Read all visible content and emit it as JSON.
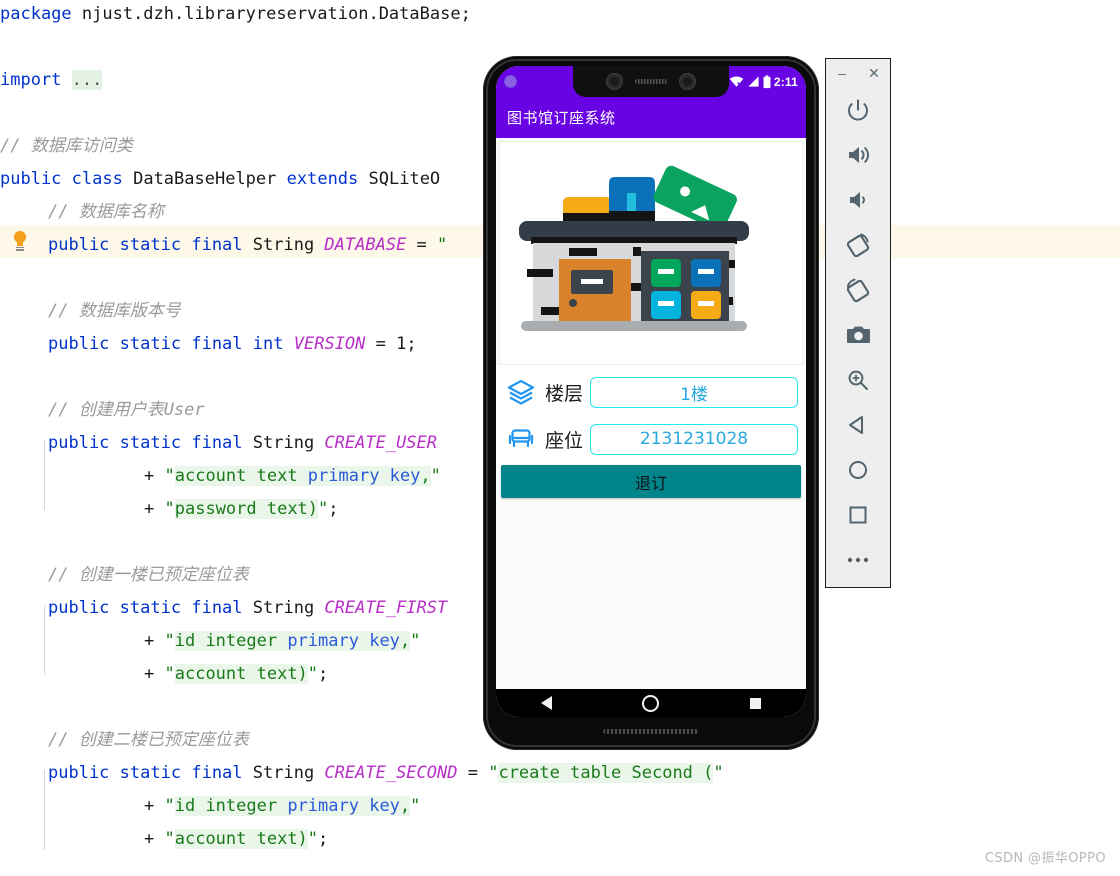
{
  "editor": {
    "lines": [
      {
        "id": "l1",
        "indent": 0,
        "highlight": false,
        "tokens": [
          {
            "t": "kw",
            "v": "package"
          },
          {
            "t": "plain",
            "v": " njust.dzh.libraryreservation.DataBase;"
          }
        ]
      },
      {
        "id": "l2",
        "indent": 0,
        "highlight": false,
        "tokens": []
      },
      {
        "id": "l3",
        "indent": 0,
        "highlight": false,
        "tokens": [
          {
            "t": "kw",
            "v": "import"
          },
          {
            "t": "plain",
            "v": " "
          },
          {
            "t": "dots",
            "v": "..."
          }
        ]
      },
      {
        "id": "l4",
        "indent": 0,
        "highlight": false,
        "tokens": []
      },
      {
        "id": "l5",
        "indent": 0,
        "highlight": false,
        "tokens": [
          {
            "t": "cmt",
            "v": "// 数据库访问类"
          }
        ]
      },
      {
        "id": "l6",
        "indent": 0,
        "highlight": false,
        "tokens": [
          {
            "t": "kw",
            "v": "public"
          },
          {
            "t": "plain",
            "v": " "
          },
          {
            "t": "kw",
            "v": "class"
          },
          {
            "t": "type",
            "v": " DataBaseHelper "
          },
          {
            "t": "kw",
            "v": "extends"
          },
          {
            "t": "type",
            "v": " SQLiteO"
          }
        ]
      },
      {
        "id": "l7",
        "indent": 1,
        "highlight": false,
        "tokens": [
          {
            "t": "cmt",
            "v": "// 数据库名称"
          }
        ]
      },
      {
        "id": "l8",
        "indent": 1,
        "highlight": true,
        "bulb": true,
        "tokens": [
          {
            "t": "kw",
            "v": "public"
          },
          {
            "t": "plain",
            "v": " "
          },
          {
            "t": "kw",
            "v": "static"
          },
          {
            "t": "plain",
            "v": " "
          },
          {
            "t": "kw",
            "v": "final"
          },
          {
            "t": "type",
            "v": " String "
          },
          {
            "t": "fieldname",
            "v": "DATABASE"
          },
          {
            "t": "plain",
            "v": " = "
          },
          {
            "t": "strq",
            "v": "\""
          }
        ]
      },
      {
        "id": "l9",
        "indent": 1,
        "highlight": false,
        "tokens": []
      },
      {
        "id": "l10",
        "indent": 1,
        "highlight": false,
        "tokens": [
          {
            "t": "cmt",
            "v": "// 数据库版本号"
          }
        ]
      },
      {
        "id": "l11",
        "indent": 1,
        "highlight": false,
        "tokens": [
          {
            "t": "kw",
            "v": "public"
          },
          {
            "t": "plain",
            "v": " "
          },
          {
            "t": "kw",
            "v": "static"
          },
          {
            "t": "plain",
            "v": " "
          },
          {
            "t": "kw",
            "v": "final"
          },
          {
            "t": "plain",
            "v": " "
          },
          {
            "t": "kw",
            "v": "int"
          },
          {
            "t": "plain",
            "v": " "
          },
          {
            "t": "fieldname",
            "v": "VERSION"
          },
          {
            "t": "plain",
            "v": " = "
          },
          {
            "t": "num",
            "v": "1"
          },
          {
            "t": "plain",
            "v": ";"
          }
        ]
      },
      {
        "id": "l12",
        "indent": 1,
        "highlight": false,
        "tokens": []
      },
      {
        "id": "l13",
        "indent": 1,
        "highlight": false,
        "tokens": [
          {
            "t": "cmt",
            "v": "// 创建用户表User"
          }
        ]
      },
      {
        "id": "l14",
        "indent": 1,
        "highlight": false,
        "tokens": [
          {
            "t": "kw",
            "v": "public"
          },
          {
            "t": "plain",
            "v": " "
          },
          {
            "t": "kw",
            "v": "static"
          },
          {
            "t": "plain",
            "v": " "
          },
          {
            "t": "kw",
            "v": "final"
          },
          {
            "t": "type",
            "v": " String "
          },
          {
            "t": "fieldname",
            "v": "CREATE_USER"
          }
        ]
      },
      {
        "id": "l15",
        "indent": 3,
        "highlight": false,
        "tokens": [
          {
            "t": "plain",
            "v": "+ "
          },
          {
            "t": "strq",
            "v": "\""
          },
          {
            "t": "str",
            "v": "account text "
          },
          {
            "t": "strkw",
            "v": "primary key"
          },
          {
            "t": "str",
            "v": ","
          },
          {
            "t": "strq",
            "v": "\""
          }
        ]
      },
      {
        "id": "l16",
        "indent": 3,
        "highlight": false,
        "tokens": [
          {
            "t": "plain",
            "v": "+ "
          },
          {
            "t": "strq",
            "v": "\""
          },
          {
            "t": "str",
            "v": "password text)"
          },
          {
            "t": "strq",
            "v": "\""
          },
          {
            "t": "plain",
            "v": ";"
          }
        ]
      },
      {
        "id": "l17",
        "indent": 1,
        "highlight": false,
        "tokens": []
      },
      {
        "id": "l18",
        "indent": 1,
        "highlight": false,
        "tokens": [
          {
            "t": "cmt",
            "v": "// 创建一楼已预定座位表"
          }
        ]
      },
      {
        "id": "l19",
        "indent": 1,
        "highlight": false,
        "tokens": [
          {
            "t": "kw",
            "v": "public"
          },
          {
            "t": "plain",
            "v": " "
          },
          {
            "t": "kw",
            "v": "static"
          },
          {
            "t": "plain",
            "v": " "
          },
          {
            "t": "kw",
            "v": "final"
          },
          {
            "t": "type",
            "v": " String "
          },
          {
            "t": "fieldname",
            "v": "CREATE_FIRST"
          }
        ]
      },
      {
        "id": "l20",
        "indent": 3,
        "highlight": false,
        "tokens": [
          {
            "t": "plain",
            "v": "+ "
          },
          {
            "t": "strq",
            "v": "\""
          },
          {
            "t": "str",
            "v": "id integer "
          },
          {
            "t": "strkw",
            "v": "primary key"
          },
          {
            "t": "str",
            "v": ","
          },
          {
            "t": "strq",
            "v": "\""
          }
        ]
      },
      {
        "id": "l21",
        "indent": 3,
        "highlight": false,
        "tokens": [
          {
            "t": "plain",
            "v": "+ "
          },
          {
            "t": "strq",
            "v": "\""
          },
          {
            "t": "str",
            "v": "account text)"
          },
          {
            "t": "strq",
            "v": "\""
          },
          {
            "t": "plain",
            "v": ";"
          }
        ]
      },
      {
        "id": "l22",
        "indent": 1,
        "highlight": false,
        "tokens": []
      },
      {
        "id": "l23",
        "indent": 1,
        "highlight": false,
        "tokens": [
          {
            "t": "cmt",
            "v": "// 创建二楼已预定座位表"
          }
        ]
      },
      {
        "id": "l24",
        "indent": 1,
        "highlight": false,
        "tokens": [
          {
            "t": "kw",
            "v": "public"
          },
          {
            "t": "plain",
            "v": " "
          },
          {
            "t": "kw",
            "v": "static"
          },
          {
            "t": "plain",
            "v": " "
          },
          {
            "t": "kw",
            "v": "final"
          },
          {
            "t": "type",
            "v": " String "
          },
          {
            "t": "fieldname",
            "v": "CREATE_SECOND"
          },
          {
            "t": "plain",
            "v": " = "
          },
          {
            "t": "strq",
            "v": "\""
          },
          {
            "t": "str",
            "v": "create table Second ("
          },
          {
            "t": "strq",
            "v": "\""
          }
        ]
      },
      {
        "id": "l25",
        "indent": 3,
        "highlight": false,
        "tokens": [
          {
            "t": "plain",
            "v": "+ "
          },
          {
            "t": "strq",
            "v": "\""
          },
          {
            "t": "str",
            "v": "id integer "
          },
          {
            "t": "strkw",
            "v": "primary key"
          },
          {
            "t": "str",
            "v": ","
          },
          {
            "t": "strq",
            "v": "\""
          }
        ]
      },
      {
        "id": "l26",
        "indent": 3,
        "highlight": false,
        "tokens": [
          {
            "t": "plain",
            "v": "+ "
          },
          {
            "t": "strq",
            "v": "\""
          },
          {
            "t": "str",
            "v": "account text)"
          },
          {
            "t": "strq",
            "v": "\""
          },
          {
            "t": "plain",
            "v": ";"
          }
        ]
      }
    ],
    "colors": {
      "keyword": "#0033cc",
      "field": "#b92ec9",
      "comment": "#9a9a9a",
      "string": "#1a7a1a",
      "string_bg": "#eaf6ea",
      "highlight_row": "#fdf8e8",
      "bulb": "#f2a01a"
    }
  },
  "emulator": {
    "status_bar": {
      "time": "2:11",
      "icons": [
        "wifi-off-icon",
        "signal-icon",
        "battery-icon"
      ]
    },
    "app_bar": {
      "title": "图书馆订座系统",
      "color": "#6803e3"
    },
    "illustration": {
      "name": "library-building-illustration",
      "colors": {
        "roof": "#333d47",
        "wall": "#d6d8d9",
        "door": "#d9822b",
        "book_yellow": "#f5ab16",
        "book_blue": "#0b72ba",
        "book_green": "#0ba360",
        "shelf_dark": "#3b444d",
        "tile_green": "#00a65a",
        "tile_blue": "#0b72ba",
        "tile_cyan": "#00b4dd",
        "tile_yellow": "#f5ab16",
        "ground": "#a9adb0"
      }
    },
    "form": {
      "rows": [
        {
          "icon": "layers-icon",
          "label": "楼层",
          "value": "1楼"
        },
        {
          "icon": "seat-icon",
          "label": "座位",
          "value": "2131231028"
        }
      ],
      "field_border": "#22e8f5",
      "field_text_color": "#26a9e0"
    },
    "submit_button": {
      "label": "退订",
      "color": "#00858a",
      "text_color": "#121212"
    },
    "nav_bar": {
      "buttons": [
        "back-icon",
        "home-icon",
        "recents-icon"
      ]
    }
  },
  "toolbar": {
    "window_buttons": [
      {
        "name": "minimize-button",
        "glyph": "–"
      },
      {
        "name": "close-button",
        "glyph": "✕"
      }
    ],
    "buttons": [
      {
        "name": "power-button",
        "label": "Power"
      },
      {
        "name": "volume-up-button",
        "label": "Volume Up"
      },
      {
        "name": "volume-down-button",
        "label": "Volume Down"
      },
      {
        "name": "rotate-left-button",
        "label": "Rotate Left"
      },
      {
        "name": "rotate-right-button",
        "label": "Rotate Right"
      },
      {
        "name": "screenshot-button",
        "label": "Take Screenshot"
      },
      {
        "name": "zoom-button",
        "label": "Zoom Mode"
      },
      {
        "name": "back-button",
        "label": "Back"
      },
      {
        "name": "home-button",
        "label": "Home"
      },
      {
        "name": "overview-button",
        "label": "Overview"
      },
      {
        "name": "more-button",
        "label": "More"
      }
    ],
    "icon_color": "#53646e",
    "background": "#eeeeee"
  },
  "watermark": {
    "text": "CSDN @振华OPPO"
  }
}
